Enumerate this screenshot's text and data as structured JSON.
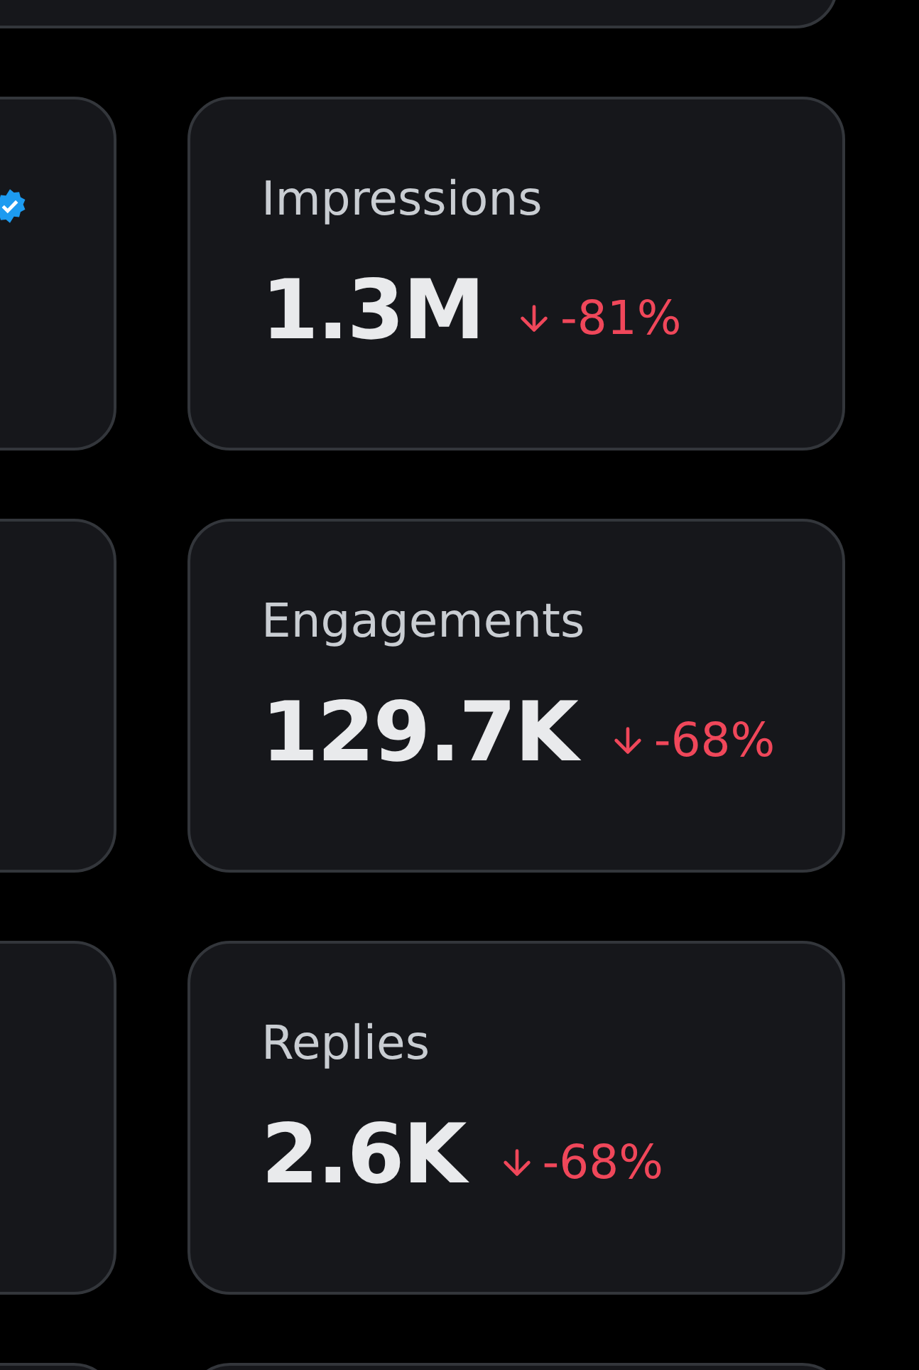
{
  "metrics": [
    {
      "label": "Impressions",
      "value": "1.3M",
      "change": "-81%",
      "kind": "down"
    },
    {
      "label": "Engagements",
      "value": "129.7K",
      "change": "-68%",
      "kind": "down"
    },
    {
      "label": "Replies",
      "value": "2.6K",
      "change": "-68%",
      "kind": "down"
    }
  ]
}
